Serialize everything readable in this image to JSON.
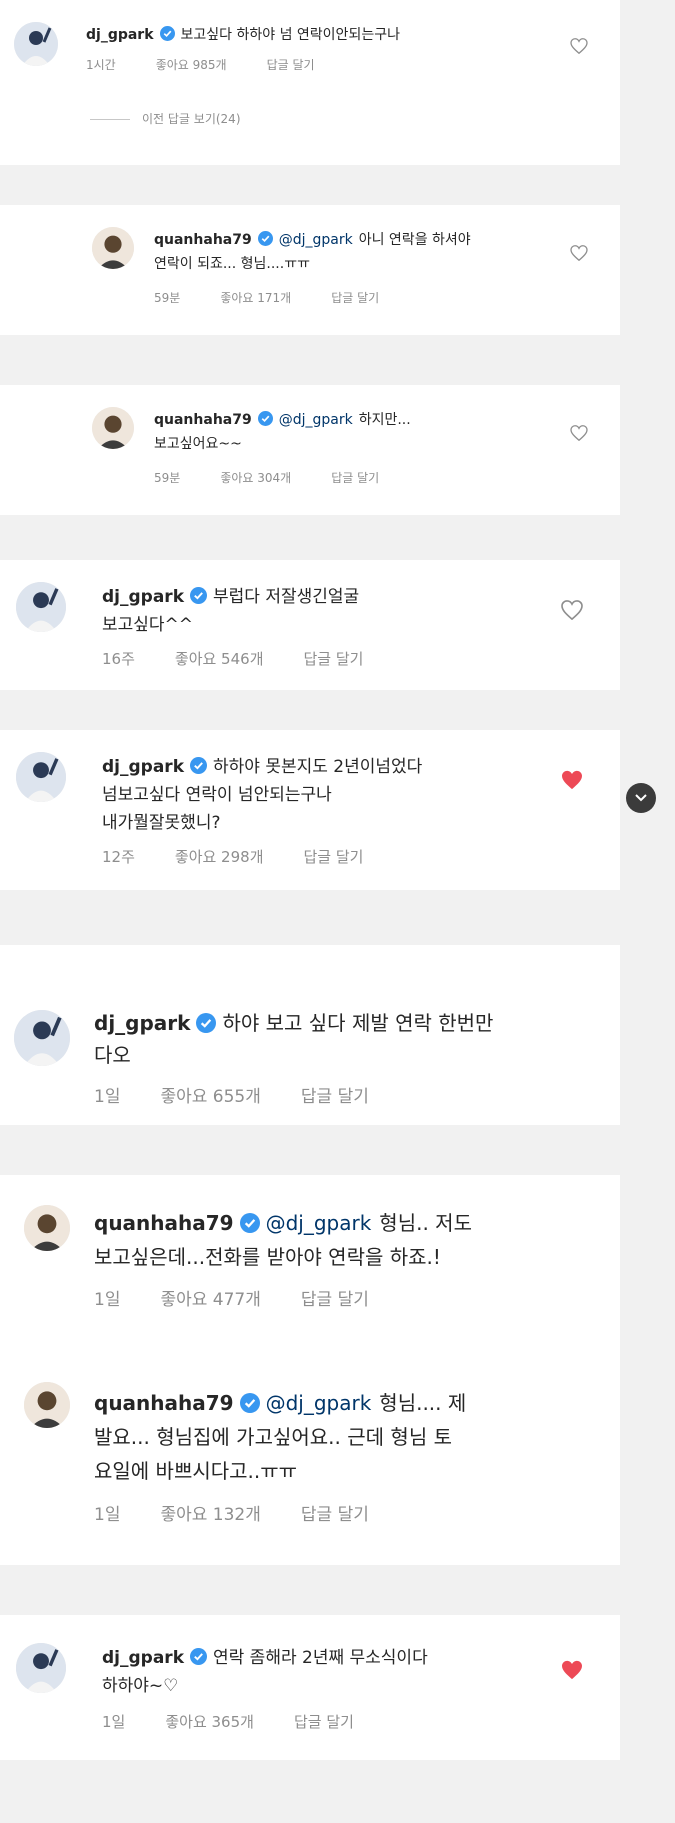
{
  "view_replies": "이전 답글 보기(24)",
  "comments": [
    {
      "user": "dj_gpark",
      "mention": "",
      "line1": "보고싶다 하하야 넘 연락이안되는구나",
      "line2": "",
      "line3": "",
      "time": "1시간",
      "likes": "좋아요 985개",
      "reply": "답글 달기",
      "liked": false
    },
    {
      "user": "quanhaha79",
      "mention": "@dj_gpark",
      "line1": "아니 연락을 하셔야",
      "line2": "연락이 되죠... 형님....ㅠㅠ",
      "line3": "",
      "time": "59분",
      "likes": "좋아요 171개",
      "reply": "답글 달기",
      "liked": false
    },
    {
      "user": "quanhaha79",
      "mention": "@dj_gpark",
      "line1": "하지만...",
      "line2": "보고싶어요~~",
      "line3": "",
      "time": "59분",
      "likes": "좋아요 304개",
      "reply": "답글 달기",
      "liked": false
    },
    {
      "user": "dj_gpark",
      "mention": "",
      "line1": "부럽다 저잘생긴얼굴",
      "line2": "보고싶다^^",
      "line3": "",
      "time": "16주",
      "likes": "좋아요 546개",
      "reply": "답글 달기",
      "liked": false
    },
    {
      "user": "dj_gpark",
      "mention": "",
      "line1": "하하야 못본지도 2년이넘었다",
      "line2": "넘보고싶다 연락이 넘안되는구나",
      "line3": "내가뭘잘못했니?",
      "time": "12주",
      "likes": "좋아요 298개",
      "reply": "답글 달기",
      "liked": true
    },
    {
      "user": "dj_gpark",
      "mention": "",
      "line1": "하야 보고 싶다 제발 연락 한번만",
      "line2": "다오",
      "line3": "",
      "time": "1일",
      "likes": "좋아요 655개",
      "reply": "답글 달기",
      "liked": false
    },
    {
      "user": "quanhaha79",
      "mention": "@dj_gpark",
      "line1": "형님.. 저도",
      "line2": "보고싶은데...전화를 받아야 연락을 하죠.!",
      "line3": "",
      "time": "1일",
      "likes": "좋아요 477개",
      "reply": "답글 달기",
      "liked": false
    },
    {
      "user": "quanhaha79",
      "mention": "@dj_gpark",
      "line1": "형님.... 제",
      "line2": "발요... 형님집에 가고싶어요.. 근데 형님 토",
      "line3": "요일에 바쁘시다고..ㅠㅠ",
      "time": "1일",
      "likes": "좋아요 132개",
      "reply": "답글 달기",
      "liked": false
    },
    {
      "user": "dj_gpark",
      "mention": "",
      "line1": "연락 좀해라 2년째 무소식이다",
      "line2": "하하야~♡",
      "line3": "",
      "time": "1일",
      "likes": "좋아요 365개",
      "reply": "답글 달기",
      "liked": true
    }
  ],
  "colors": {
    "verified": "#3897f0",
    "heart_liked": "#ed4956",
    "mention": "#003569",
    "meta": "#8e8e8e"
  }
}
